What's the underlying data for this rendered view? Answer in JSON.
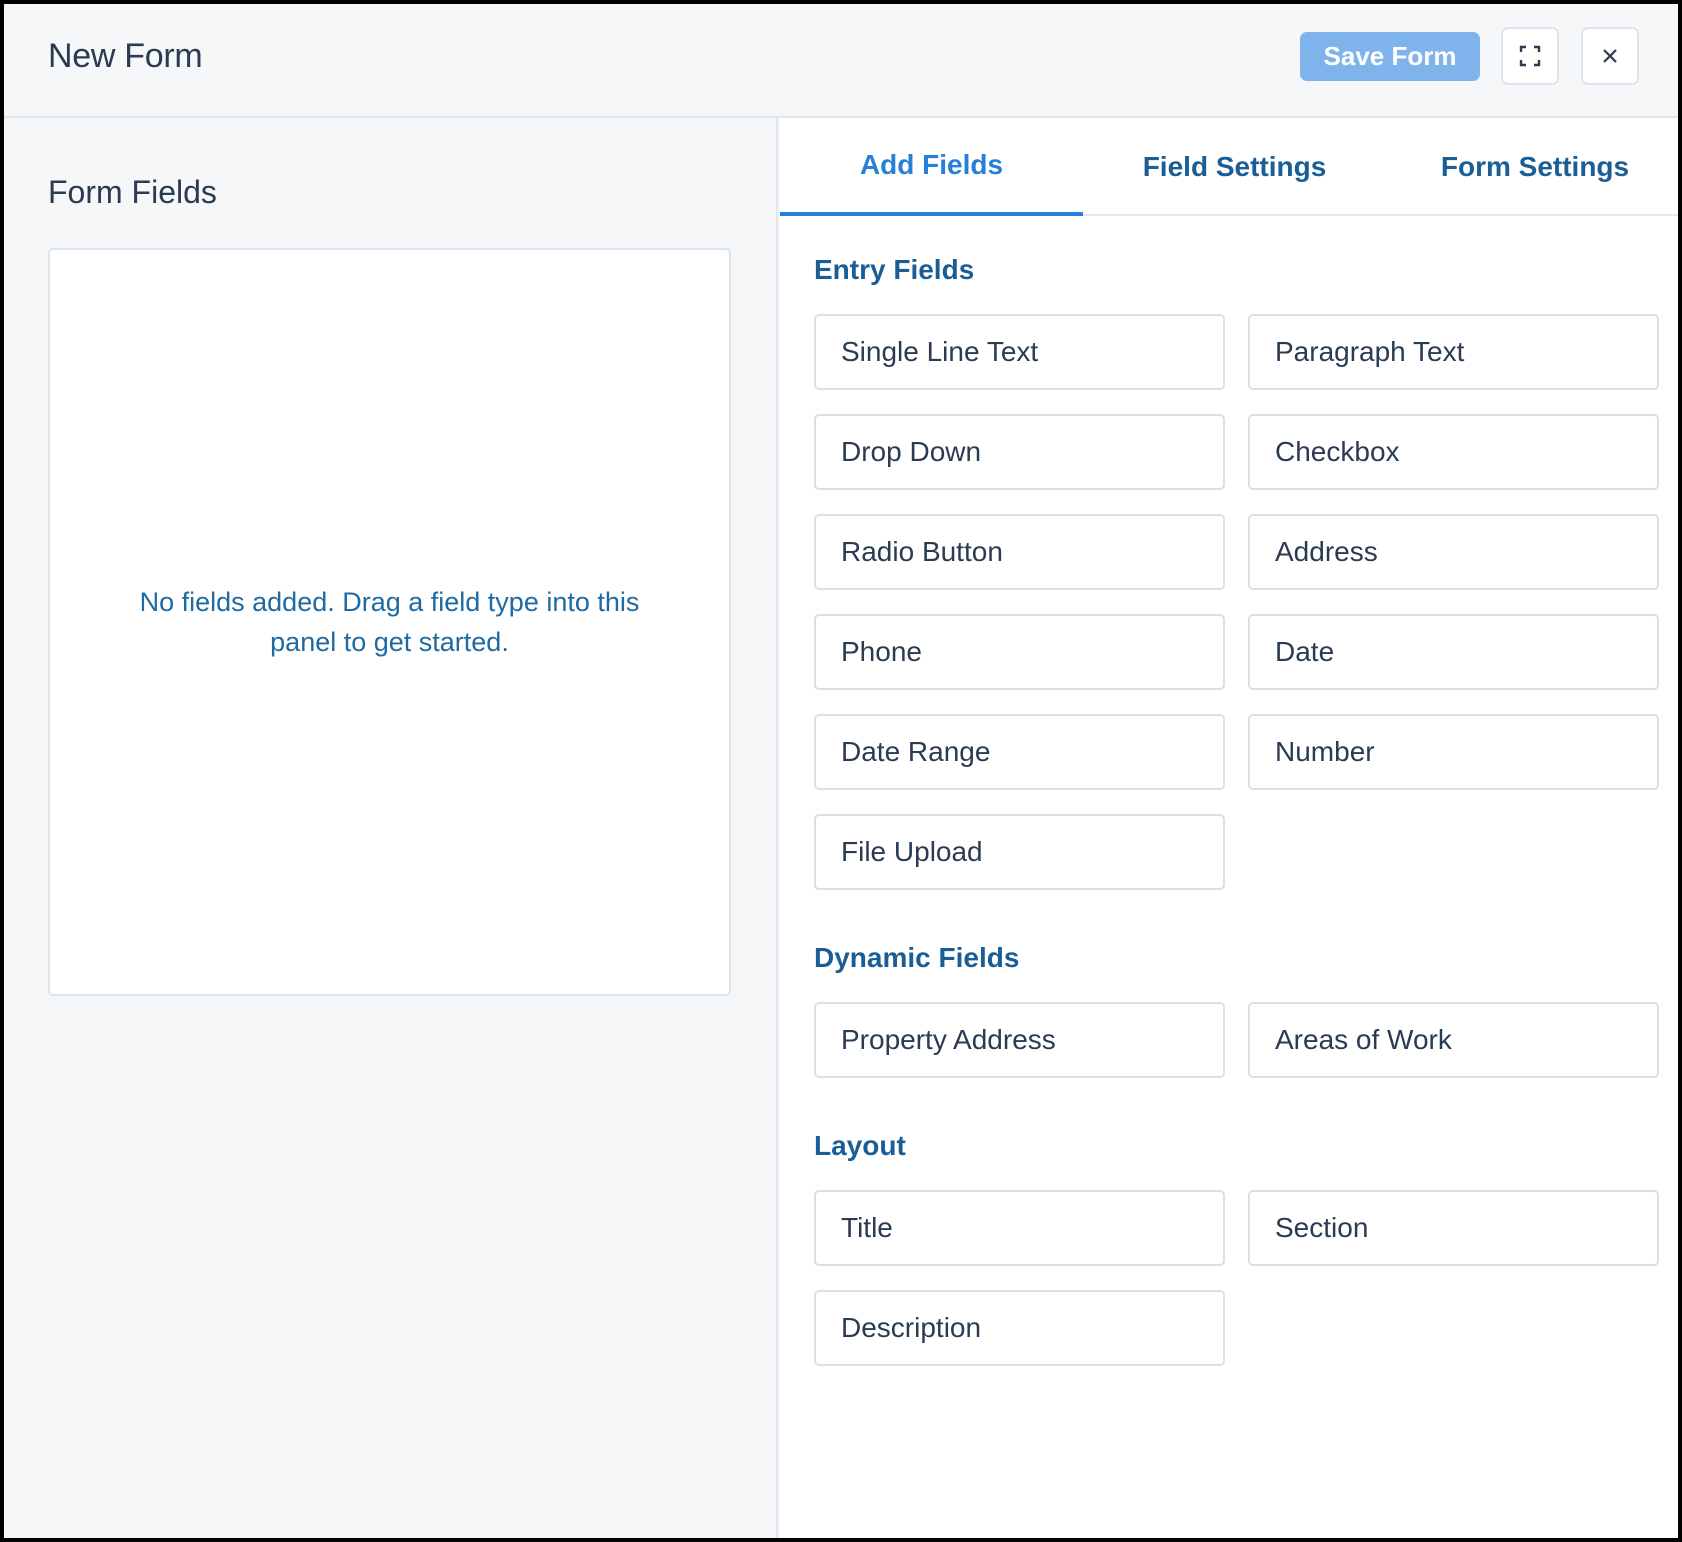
{
  "header": {
    "title": "New Form",
    "save_label": "Save Form",
    "expand_icon": "expand-icon",
    "close_icon": "close-icon",
    "close_glyph": "×"
  },
  "left": {
    "title": "Form Fields",
    "empty_message": "No fields added. Drag a field type into this panel to get started."
  },
  "tabs": [
    "Add Fields",
    "Field Settings",
    "Form Settings"
  ],
  "active_tab": "Add Fields",
  "sections": {
    "entry": {
      "title": "Entry Fields",
      "fields": [
        "Single Line Text",
        "Paragraph Text",
        "Drop Down",
        "Checkbox",
        "Radio Button",
        "Address",
        "Phone",
        "Date",
        "Date Range",
        "Number",
        "File Upload"
      ]
    },
    "dynamic": {
      "title": "Dynamic Fields",
      "fields": [
        "Property Address",
        "Areas of Work"
      ]
    },
    "layout": {
      "title": "Layout",
      "fields": [
        "Title",
        "Section",
        "Description"
      ]
    }
  },
  "colors": {
    "accent": "#2680d9",
    "save_button": "#7fb3ec",
    "section_text": "#1b5e96",
    "body_text": "#2a3b52"
  }
}
